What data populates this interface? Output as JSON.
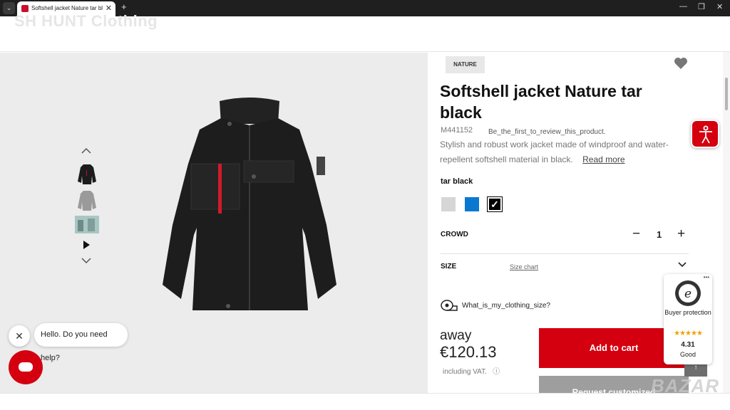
{
  "browser": {
    "tab_title": "Softshell jacket Nature tar black",
    "new_tab": "+",
    "close": "✕",
    "minimize": "—",
    "restore": "❐",
    "close_window": "✕"
  },
  "header": {
    "logo": "SH HUNT Clothing"
  },
  "gallery": {
    "thumbnails": [
      "jacket-front",
      "jacket-grey",
      "jacket-scene"
    ],
    "selected_thumbnail": "jacket-front"
  },
  "product": {
    "badge": "NATURE",
    "title": "Softshell jacket Nature tar black",
    "sku": "M441152",
    "review_link": "Be_the_first_to_review_this_product.",
    "description": "Stylish and robust work jacket made of windproof and water-repellent softshell material in black.",
    "read_more": "Read more",
    "color_label": "tar black",
    "colors": [
      "#d6d6d6",
      "#0a78d1",
      "#000000"
    ],
    "selected_color": "#000000",
    "quantity_label": "CROWD",
    "quantity": "1",
    "size_label": "SIZE",
    "size_chart": "Size chart",
    "which_size": "What_is_my_clothing_size?",
    "price_prefix": "away",
    "price": "€120.13",
    "vat": "including VAT.",
    "add_to_cart": "Add to cart",
    "request": "Request customized"
  },
  "chat": {
    "close": "✕",
    "greeting": "Hello. Do you need help?"
  },
  "trust": {
    "label": "Buyer protection",
    "rating": "4.31",
    "rating_text": "Good",
    "dots": "•••"
  },
  "watermark": "BAZAR"
}
